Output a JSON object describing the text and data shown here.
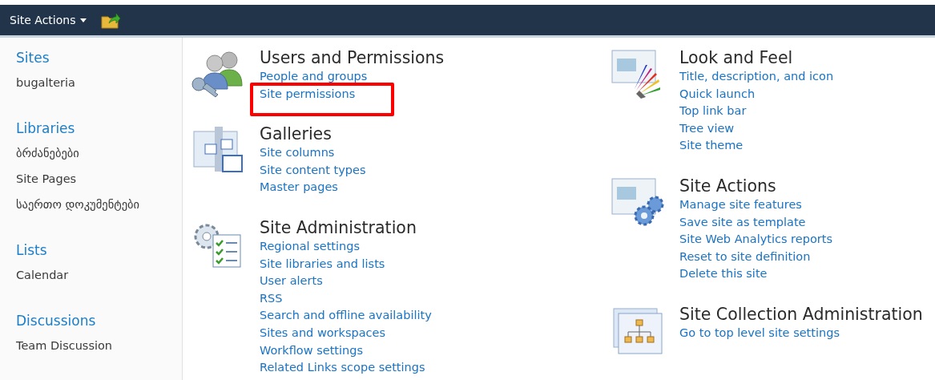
{
  "ribbon": {
    "menu_label": "Site Actions"
  },
  "sidebar": {
    "groups": [
      {
        "heading": "Sites",
        "items": [
          "bugalteria"
        ]
      },
      {
        "heading": "Libraries",
        "items": [
          "ბრძანებები",
          "Site Pages",
          "საერთო დოკუმენტები"
        ]
      },
      {
        "heading": "Lists",
        "items": [
          "Calendar"
        ]
      },
      {
        "heading": "Discussions",
        "items": [
          "Team Discussion"
        ]
      }
    ]
  },
  "columns": [
    [
      {
        "kind": "users",
        "title": "Users and Permissions",
        "links": [
          {
            "label": "People and groups",
            "highlighted": false
          },
          {
            "label": "Site permissions",
            "highlighted": true
          }
        ]
      },
      {
        "kind": "galleries",
        "title": "Galleries",
        "links": [
          {
            "label": "Site columns",
            "highlighted": false
          },
          {
            "label": "Site content types",
            "highlighted": false
          },
          {
            "label": "Master pages",
            "highlighted": false
          }
        ]
      },
      {
        "kind": "admin",
        "title": "Site Administration",
        "links": [
          {
            "label": "Regional settings",
            "highlighted": false
          },
          {
            "label": "Site libraries and lists",
            "highlighted": false
          },
          {
            "label": "User alerts",
            "highlighted": false
          },
          {
            "label": "RSS",
            "highlighted": false
          },
          {
            "label": "Search and offline availability",
            "highlighted": false
          },
          {
            "label": "Sites and workspaces",
            "highlighted": false
          },
          {
            "label": "Workflow settings",
            "highlighted": false
          },
          {
            "label": "Related Links scope settings",
            "highlighted": false
          }
        ]
      }
    ],
    [
      {
        "kind": "look",
        "title": "Look and Feel",
        "links": [
          {
            "label": "Title, description, and icon",
            "highlighted": false
          },
          {
            "label": "Quick launch",
            "highlighted": false
          },
          {
            "label": "Top link bar",
            "highlighted": false
          },
          {
            "label": "Tree view",
            "highlighted": false
          },
          {
            "label": "Site theme",
            "highlighted": false
          }
        ]
      },
      {
        "kind": "actions",
        "title": "Site Actions",
        "links": [
          {
            "label": "Manage site features",
            "highlighted": false
          },
          {
            "label": "Save site as template",
            "highlighted": false
          },
          {
            "label": "Site Web Analytics reports",
            "highlighted": false
          },
          {
            "label": "Reset to site definition",
            "highlighted": false
          },
          {
            "label": "Delete this site",
            "highlighted": false
          }
        ]
      },
      {
        "kind": "collection",
        "title": "Site Collection Administration",
        "links": [
          {
            "label": "Go to top level site settings",
            "highlighted": false
          }
        ]
      }
    ]
  ]
}
